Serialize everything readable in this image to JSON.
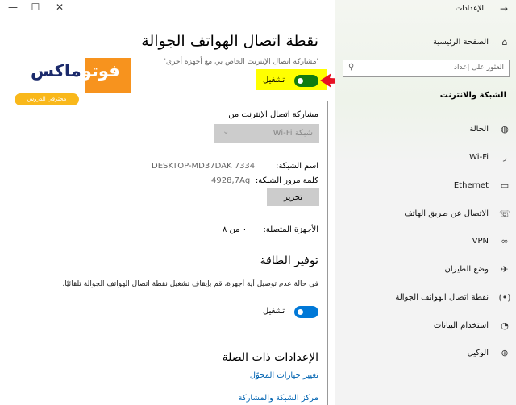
{
  "window": {
    "title": "الإعدادات",
    "controls": [
      "minimize",
      "maximize",
      "close"
    ]
  },
  "nav": {
    "back_icon": "arrow-right-icon",
    "home_label": "الصفحة الرئيسية",
    "search_placeholder": "العثور على إعداد",
    "section": "الشبكة والانترنت",
    "items": [
      {
        "label": "الحالة",
        "icon": "globe-status-icon"
      },
      {
        "label": "Wi-Fi",
        "icon": "wifi-icon"
      },
      {
        "label": "Ethernet",
        "icon": "ethernet-icon"
      },
      {
        "label": "الاتصال عن طريق الهاتف",
        "icon": "dialup-icon"
      },
      {
        "label": "VPN",
        "icon": "vpn-icon"
      },
      {
        "label": "وضع الطيران",
        "icon": "airplane-icon"
      },
      {
        "label": "نقطة اتصال الهواتف الجوالة",
        "icon": "hotspot-icon"
      },
      {
        "label": "استخدام البيانات",
        "icon": "data-usage-icon"
      },
      {
        "label": "الوكيل",
        "icon": "proxy-globe-icon"
      }
    ]
  },
  "main": {
    "title": "نقطة اتصال الهواتف الجوالة",
    "share_desc": "'مشاركة اتصال الإنترنت الخاص بي مع أجهزة أخرى'",
    "share_toggle": {
      "label": "تشغيل",
      "on": true,
      "color": "#107c10"
    },
    "share_from_label": "مشاركة اتصال الإنترنت من",
    "share_from_value": "شبكة Wi-Fi",
    "network_name_label": "اسم الشبكة:",
    "network_name": "DESKTOP-MD37DAK 7334",
    "password_label": "كلمة مرور الشبكة:",
    "password": "4928,7Ag",
    "edit_button": "تحرير",
    "devices_label": "الأجهزة المتصلة:",
    "devices_value": "٠ من ٨",
    "power_title": "توفير الطاقة",
    "power_desc": "في حالة عدم توصيل أية أجهزة، قم بإيقاف تشغيل نقطة اتصال الهواتف الجوالة تلقائيًا.",
    "power_toggle": {
      "label": "تشغيل",
      "on": true,
      "color": "#0078d7"
    },
    "related_title": "الإعدادات ذات الصلة",
    "links": [
      "تغيير خيارات المحوّل",
      "مركز الشبكة والمشاركة"
    ]
  },
  "watermark": {
    "brand": "فوتوماكس",
    "tagline": "محترفي الدروس"
  },
  "colors": {
    "accent": "#0078d7",
    "highlight": "#ffff00",
    "arrow": "#e81123"
  }
}
